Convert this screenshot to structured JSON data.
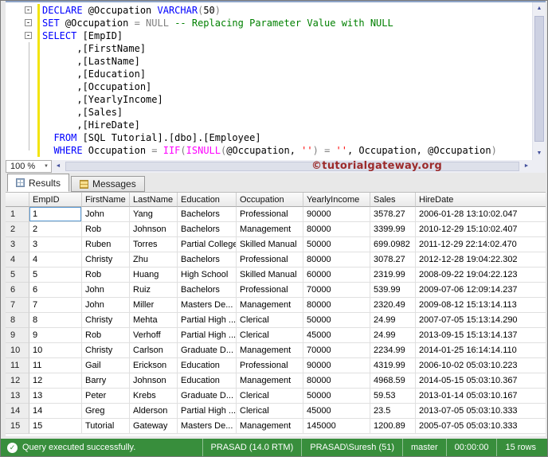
{
  "colors": {
    "keyword": "#0000ff",
    "comment": "#008000",
    "system_function": "#ff00ff",
    "string_literal": "#ff0000",
    "operator_gray": "#808080",
    "status_bar": "#388e3c",
    "watermark": "#9c2b2b"
  },
  "icons": {
    "check": "✓",
    "caret_down": "▼",
    "arrow_up": "▲",
    "arrow_down": "▼",
    "arrow_left": "◄",
    "arrow_right": "►",
    "fold_minus": "-"
  },
  "editor": {
    "zoom_level": "100 %",
    "watermark": "©tutorialgateway.org",
    "code_lines": [
      {
        "fold": true,
        "segments": [
          {
            "c": "kw",
            "t": "DECLARE"
          },
          {
            "c": "pl",
            "t": " @Occupation "
          },
          {
            "c": "kw",
            "t": "VARCHAR"
          },
          {
            "c": "op",
            "t": "("
          },
          {
            "c": "pl",
            "t": "50"
          },
          {
            "c": "op",
            "t": ")"
          }
        ]
      },
      {
        "fold": true,
        "segments": [
          {
            "c": "kw",
            "t": "SET"
          },
          {
            "c": "pl",
            "t": " @Occupation "
          },
          {
            "c": "op",
            "t": "= NULL "
          },
          {
            "c": "cm",
            "t": "-- Replacing Parameter Value with NULL"
          }
        ]
      },
      {
        "fold": true,
        "segments": [
          {
            "c": "kw",
            "t": "SELECT"
          },
          {
            "c": "pl",
            "t": " [EmpID]"
          }
        ]
      },
      {
        "fold": false,
        "segments": [
          {
            "c": "pl",
            "t": "      ,[FirstName]"
          }
        ]
      },
      {
        "fold": false,
        "segments": [
          {
            "c": "pl",
            "t": "      ,[LastName]"
          }
        ]
      },
      {
        "fold": false,
        "segments": [
          {
            "c": "pl",
            "t": "      ,[Education]"
          }
        ]
      },
      {
        "fold": false,
        "segments": [
          {
            "c": "pl",
            "t": "      ,[Occupation]"
          }
        ]
      },
      {
        "fold": false,
        "segments": [
          {
            "c": "pl",
            "t": "      ,[YearlyIncome]"
          }
        ]
      },
      {
        "fold": false,
        "segments": [
          {
            "c": "pl",
            "t": "      ,[Sales]"
          }
        ]
      },
      {
        "fold": false,
        "segments": [
          {
            "c": "pl",
            "t": "      ,[HireDate]"
          }
        ]
      },
      {
        "fold": false,
        "segments": [
          {
            "c": "pl",
            "t": "  "
          },
          {
            "c": "kw",
            "t": "FROM"
          },
          {
            "c": "pl",
            "t": " [SQL Tutorial].[dbo].[Employee]"
          }
        ]
      },
      {
        "fold": false,
        "segments": [
          {
            "c": "pl",
            "t": "  "
          },
          {
            "c": "kw",
            "t": "WHERE"
          },
          {
            "c": "pl",
            "t": " Occupation "
          },
          {
            "c": "op",
            "t": "= "
          },
          {
            "c": "fn",
            "t": "IIF"
          },
          {
            "c": "op",
            "t": "("
          },
          {
            "c": "fn",
            "t": "ISNULL"
          },
          {
            "c": "op",
            "t": "("
          },
          {
            "c": "pl",
            "t": "@Occupation, "
          },
          {
            "c": "str",
            "t": "''"
          },
          {
            "c": "op",
            "t": ") = "
          },
          {
            "c": "str",
            "t": "''"
          },
          {
            "c": "pl",
            "t": ", Occupation, @Occupation"
          },
          {
            "c": "op",
            "t": ")"
          }
        ]
      }
    ]
  },
  "tabs": [
    {
      "label": "Results"
    },
    {
      "label": "Messages"
    }
  ],
  "grid": {
    "columns": [
      "",
      "EmpID",
      "FirstName",
      "LastName",
      "Education",
      "Occupation",
      "YearlyIncome",
      "Sales",
      "HireDate"
    ],
    "focused_cell": {
      "row": 0,
      "col": 1
    },
    "rows": [
      [
        "1",
        "1",
        "John",
        "Yang",
        "Bachelors",
        "Professional",
        "90000",
        "3578.27",
        "2006-01-28 13:10:02.047"
      ],
      [
        "2",
        "2",
        "Rob",
        "Johnson",
        "Bachelors",
        "Management",
        "80000",
        "3399.99",
        "2010-12-29 15:10:02.407"
      ],
      [
        "3",
        "3",
        "Ruben",
        "Torres",
        "Partial College",
        "Skilled Manual",
        "50000",
        "699.0982",
        "2011-12-29 22:14:02.470"
      ],
      [
        "4",
        "4",
        "Christy",
        "Zhu",
        "Bachelors",
        "Professional",
        "80000",
        "3078.27",
        "2012-12-28 19:04:22.302"
      ],
      [
        "5",
        "5",
        "Rob",
        "Huang",
        "High School",
        "Skilled Manual",
        "60000",
        "2319.99",
        "2008-09-22 19:04:22.123"
      ],
      [
        "6",
        "6",
        "John",
        "Ruiz",
        "Bachelors",
        "Professional",
        "70000",
        "539.99",
        "2009-07-06 12:09:14.237"
      ],
      [
        "7",
        "7",
        "John",
        "Miller",
        "Masters De...",
        "Management",
        "80000",
        "2320.49",
        "2009-08-12 15:13:14.113"
      ],
      [
        "8",
        "8",
        "Christy",
        "Mehta",
        "Partial High ...",
        "Clerical",
        "50000",
        "24.99",
        "2007-07-05 15:13:14.290"
      ],
      [
        "9",
        "9",
        "Rob",
        "Verhoff",
        "Partial High ...",
        "Clerical",
        "45000",
        "24.99",
        "2013-09-15 15:13:14.137"
      ],
      [
        "10",
        "10",
        "Christy",
        "Carlson",
        "Graduate D...",
        "Management",
        "70000",
        "2234.99",
        "2014-01-25 16:14:14.110"
      ],
      [
        "11",
        "11",
        "Gail",
        "Erickson",
        "Education",
        "Professional",
        "90000",
        "4319.99",
        "2006-10-02 05:03:10.223"
      ],
      [
        "12",
        "12",
        "Barry",
        "Johnson",
        "Education",
        "Management",
        "80000",
        "4968.59",
        "2014-05-15 05:03:10.367"
      ],
      [
        "13",
        "13",
        "Peter",
        "Krebs",
        "Graduate D...",
        "Clerical",
        "50000",
        "59.53",
        "2013-01-14 05:03:10.167"
      ],
      [
        "14",
        "14",
        "Greg",
        "Alderson",
        "Partial High ...",
        "Clerical",
        "45000",
        "23.5",
        "2013-07-05 05:03:10.333"
      ],
      [
        "15",
        "15",
        "Tutorial",
        "Gateway",
        "Masters De...",
        "Management",
        "145000",
        "1200.89",
        "2005-07-05 05:03:10.333"
      ]
    ]
  },
  "status": {
    "message": "Query executed successfully.",
    "server": "PRASAD (14.0 RTM)",
    "user": "PRASAD\\Suresh (51)",
    "database": "master",
    "elapsed": "00:00:00",
    "row_count": "15 rows"
  }
}
